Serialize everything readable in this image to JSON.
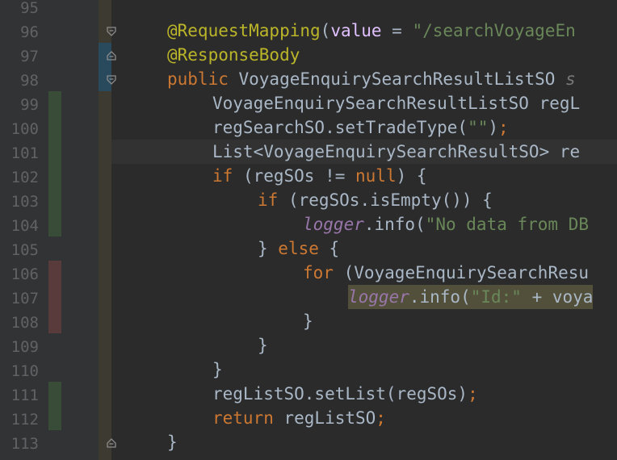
{
  "editor": {
    "line_numbers": [
      "95",
      "96",
      "97",
      "98",
      "99",
      "100",
      "101",
      "102",
      "103",
      "104",
      "105",
      "106",
      "107",
      "108",
      "109",
      "110",
      "111",
      "112",
      "113"
    ],
    "line96": {
      "ann": "@RequestMapping",
      "p1": "(",
      "param": "value",
      "p2": " = ",
      "str": "\"/searchVoyageEn"
    },
    "line97": {
      "ann": "@ResponseBody"
    },
    "line98": {
      "kw": "public",
      "rest": " VoyageEnquirySearchResultListSO ",
      "hint": "s"
    },
    "line99": {
      "text": "VoyageEnquirySearchResultListSO regL"
    },
    "line100": {
      "a": "regSearchSO.setTradeType(",
      "str": "\"\"",
      "b": ")",
      "semi": ";"
    },
    "line101": {
      "text": "List<VoyageEnquirySearchResultSO> re"
    },
    "line102": {
      "kw1": "if",
      "a": " (regSOs != ",
      "kw2": "null",
      "b": ") {"
    },
    "line103": {
      "kw": "if",
      "a": " (regSOs.isEmpty()) {"
    },
    "line104": {
      "ital": "logger",
      "a": ".info(",
      "str": "\"No data from DB"
    },
    "line105": {
      "a": "} ",
      "kw": "else",
      "b": " {"
    },
    "line106": {
      "kw": "for",
      "a": " (VoyageEnquirySearchResu"
    },
    "line107": {
      "ital": "logger",
      "a": ".info(",
      "str": "\"Id:\"",
      "b": " + voya"
    },
    "line108": {
      "text": "}"
    },
    "line109": {
      "text": "}"
    },
    "line110": {
      "text": "}"
    },
    "line111": {
      "a": "regListSO.setList(regSOs)",
      "semi": ";"
    },
    "line112": {
      "kw": "return",
      "a": " regListSO",
      "semi": ";"
    },
    "line113": {
      "text": "}"
    }
  },
  "colors": {
    "background": "#2b2b2b",
    "gutter": "#313335",
    "keyword": "#cc7832",
    "annotation": "#bbb529",
    "string": "#6a8759",
    "static_field": "#9876aa",
    "text": "#a9b7c6",
    "diff_added": "#384c38",
    "diff_deleted": "#5a3b3b",
    "diff_modified": "#294a5c"
  },
  "icons": [
    "fold-marker-icon"
  ]
}
